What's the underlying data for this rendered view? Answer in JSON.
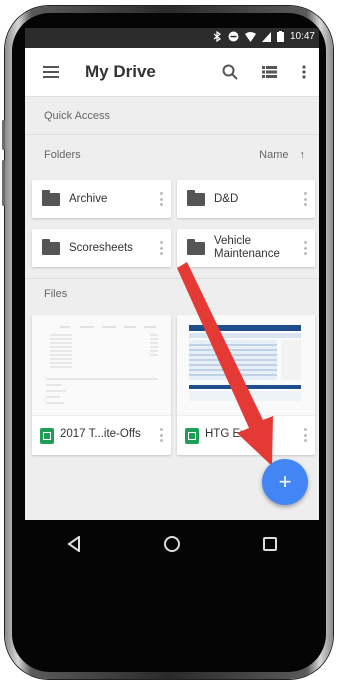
{
  "statusbar": {
    "time": "10:47"
  },
  "appbar": {
    "title": "My Drive"
  },
  "sections": {
    "quick_access": "Quick Access",
    "folders": "Folders",
    "files": "Files",
    "sort_label": "Name",
    "sort_arrow": "↑"
  },
  "folders": [
    {
      "label": "Archive"
    },
    {
      "label": "D&D"
    },
    {
      "label": "Scoresheets"
    },
    {
      "label": "Vehicle\nMaintenance"
    }
  ],
  "files": [
    {
      "name": "2017 T...ite-Offs"
    },
    {
      "name": "HTG Ex...e"
    }
  ],
  "fab": {
    "label": "+"
  },
  "colors": {
    "fab": "#4285f4",
    "sheets_green": "#1e9e57",
    "arrow": "#e53935"
  },
  "icons": [
    "menu-icon",
    "search-icon",
    "list-view-icon",
    "more-vert-icon",
    "folder-icon",
    "sheets-icon",
    "back-icon",
    "home-icon",
    "recents-icon"
  ]
}
